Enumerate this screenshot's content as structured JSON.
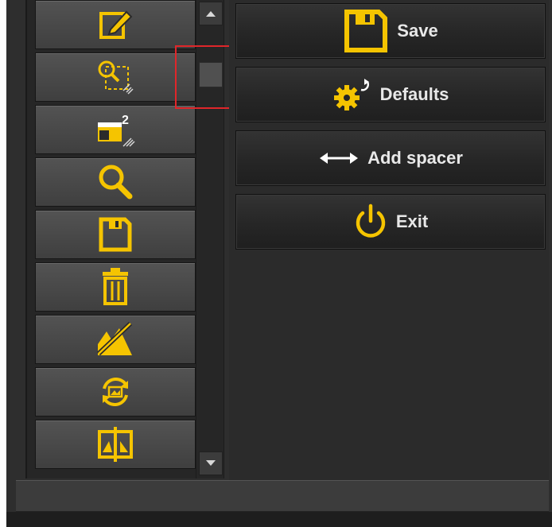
{
  "actions": {
    "save_label": "Save",
    "defaults_label": "Defaults",
    "add_spacer_label": "Add spacer",
    "exit_label": "Exit"
  },
  "toolbar_icons": [
    "edit-icon",
    "zoom-selection-icon",
    "multi-page-icon",
    "zoom-icon",
    "save-icon",
    "trash-icon",
    "hide-image-icon",
    "rotate-image-icon",
    "split-icon"
  ],
  "colors": {
    "accent": "#f5c400",
    "panel_bg": "#2b2b2b",
    "button_text": "#e8e8e8",
    "highlight": "#e0262a"
  }
}
